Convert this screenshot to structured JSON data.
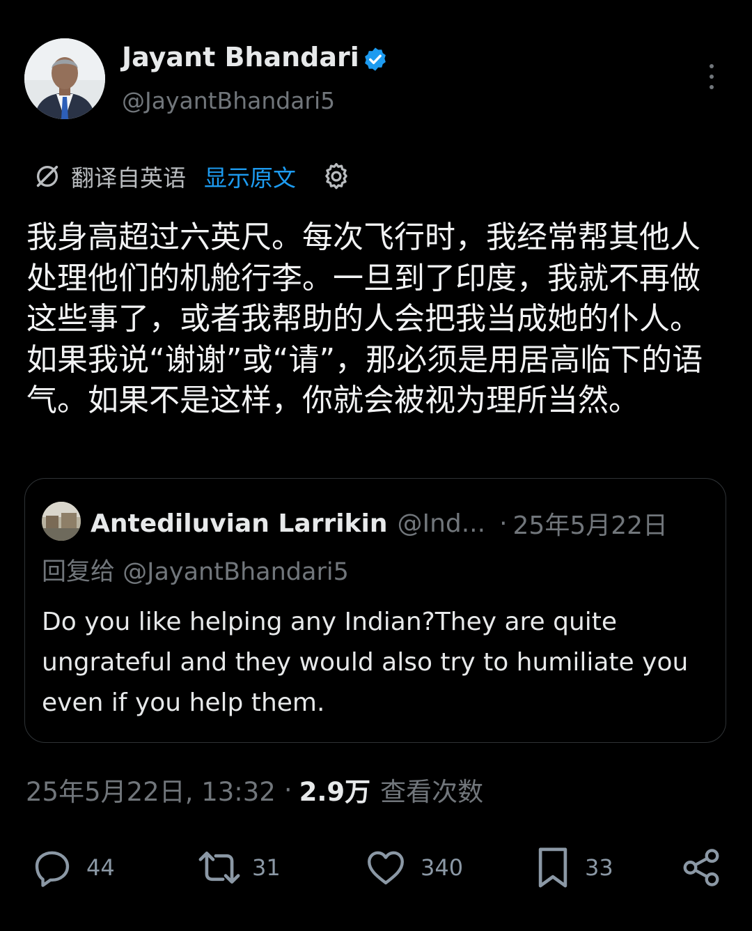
{
  "author": {
    "name": "Jayant Bhandari",
    "handle": "@JayantBhandari5",
    "verified": true,
    "avatar_icon": "profile-photo"
  },
  "translation": {
    "label": "翻译自英语",
    "show_original": "显示原文",
    "icon": "translate-icon",
    "settings_icon": "gear-icon"
  },
  "post": {
    "text": "我身高超过六英尺。每次飞行时，我经常帮其他人处理他们的机舱行李。一旦到了印度，我就不再做这些事了，或者我帮助的人会把我当成她的仆人。如果我说“谢谢”或“请”，那必须是用居高临下的语气。如果不是这样，你就会被视为理所当然。"
  },
  "quoted": {
    "name": "Antediluvian Larrikin",
    "handle": "@Ind...",
    "separator": "·",
    "date": "25年5月22日",
    "reply_to": "回复给 @JayantBhandari5",
    "text": "Do you like helping any Indian?They are quite ungrateful and they would also try to humiliate you even if you help them."
  },
  "meta": {
    "timestamp": "25年5月22日, 13:32",
    "separator": "·",
    "views": "2.9万",
    "views_label": "查看次数"
  },
  "actions": {
    "replies": "44",
    "reposts": "31",
    "likes": "340",
    "bookmarks": "33"
  },
  "colors": {
    "background": "#000000",
    "accent": "#1d9bf0",
    "secondary_text": "#71767b",
    "primary_text": "#e7e9ea"
  }
}
